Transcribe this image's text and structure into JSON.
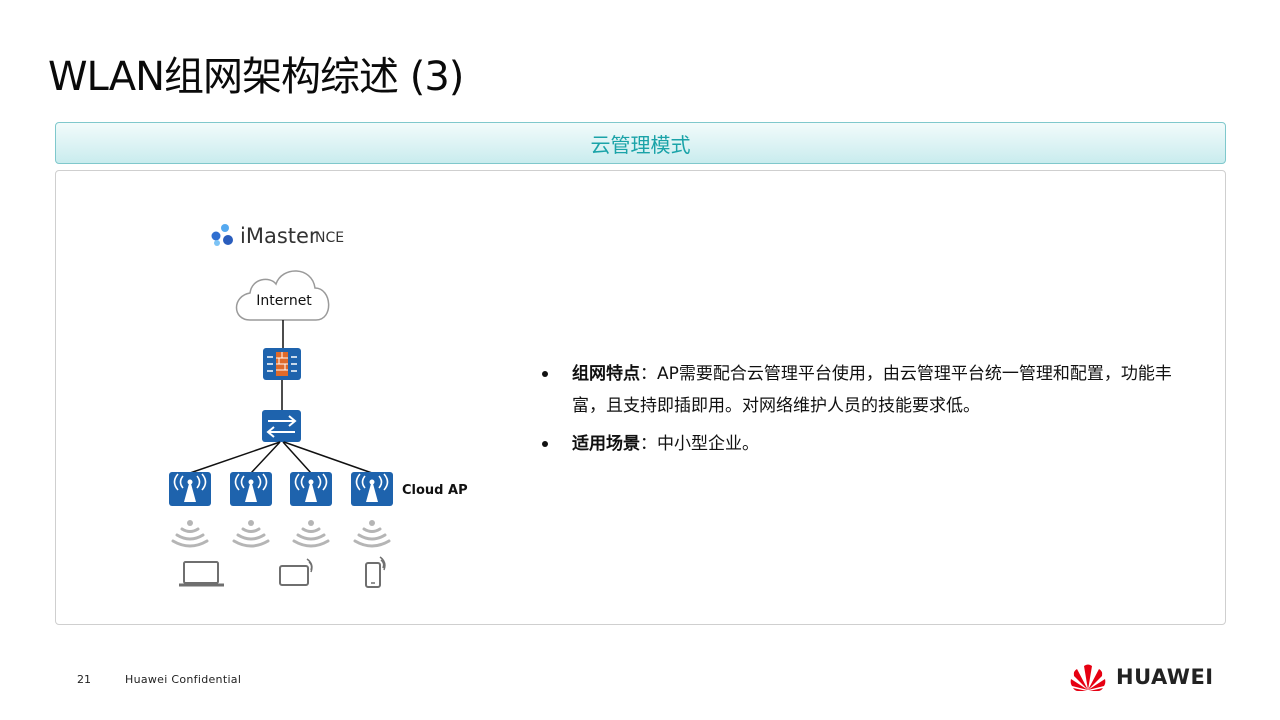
{
  "slide": {
    "title": "WLAN组网架构综述 (3)",
    "section_header": "云管理模式"
  },
  "diagram": {
    "controller_brand": "iMaster",
    "controller_product": "NCE",
    "cloud_label": "Internet",
    "ap_label": "Cloud AP",
    "access_points": 4,
    "colors": {
      "device_blue": "#1e63ad",
      "cloud_stroke": "#9a9a9a",
      "wifi_gray": "#b5b5b5",
      "terminal_gray": "#6f6f6f",
      "firewall_orange": "#e06a2a"
    },
    "icons": [
      "firewall-icon",
      "switch-icon",
      "access-point-icon",
      "wifi-signal-icon",
      "laptop-icon",
      "tablet-icon",
      "phone-icon",
      "imaster-logo-icon",
      "cloud-icon"
    ]
  },
  "bullets": [
    {
      "term": "组网特点",
      "separator": "：",
      "text": "AP需要配合云管理平台使用，由云管理平台统一管理和配置，功能丰富，且支持即插即用。对网络维护人员的技能要求低。"
    },
    {
      "term": "适用场景",
      "separator": "：",
      "text": "中小型企业。"
    }
  ],
  "footer": {
    "page_number": "21",
    "confidential": "Huawei Confidential",
    "brand": "HUAWEI",
    "brand_color": "#e60012"
  }
}
